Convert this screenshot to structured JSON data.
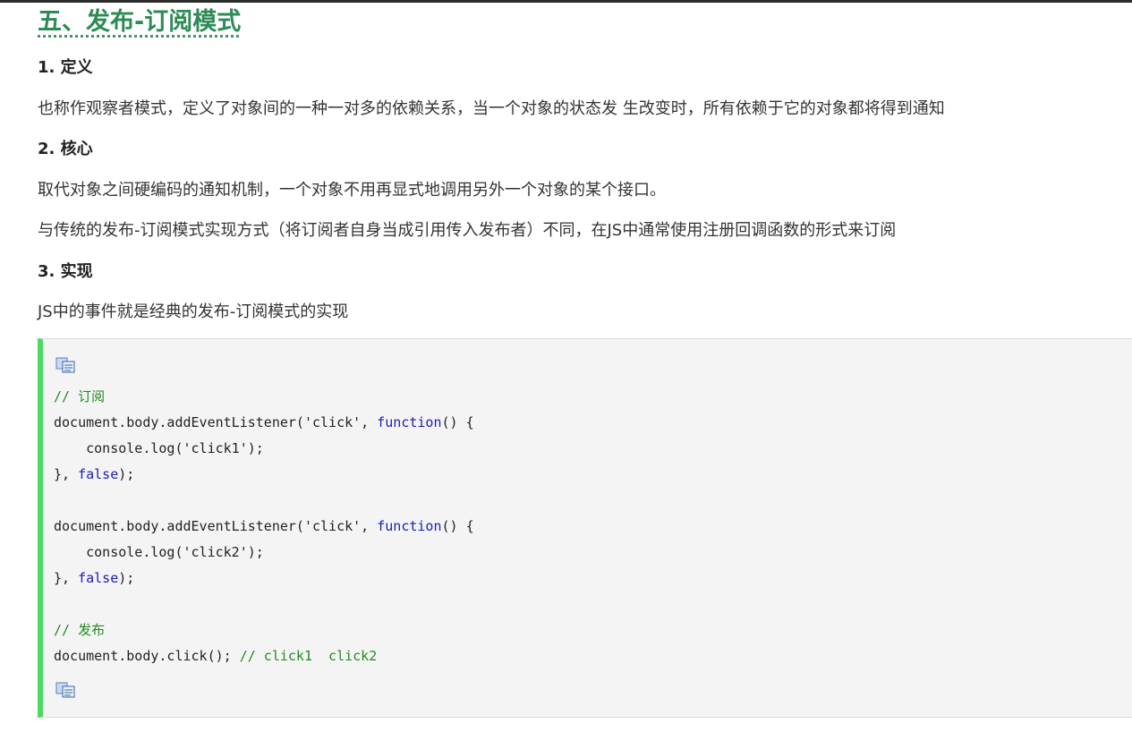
{
  "article": {
    "section_title": "五、发布-订阅模式",
    "heading_1": "1. 定义",
    "para_1": "也称作观察者模式，定义了对象间的一种一对多的依赖关系，当一个对象的状态发 生改变时，所有依赖于它的对象都将得到通知",
    "heading_2": "2. 核心",
    "para_2": "取代对象之间硬编码的通知机制，一个对象不用再显式地调用另外一个对象的某个接口。",
    "para_3": "与传统的发布-订阅模式实现方式（将订阅者自身当成引用传入发布者）不同，在JS中通常使用注册回调函数的形式来订阅",
    "heading_3": "3. 实现",
    "para_4": "JS中的事件就是经典的发布-订阅模式的实现"
  },
  "code": {
    "copy_icon": "copy-icon",
    "lines": [
      [
        {
          "t": "// 订阅",
          "c": "cmt"
        }
      ],
      [
        {
          "t": "document.body.addEventListener('click', ",
          "c": ""
        },
        {
          "t": "function",
          "c": "kw"
        },
        {
          "t": "() {",
          "c": ""
        }
      ],
      [
        {
          "t": "    console.log('click1');",
          "c": ""
        }
      ],
      [
        {
          "t": "}, ",
          "c": ""
        },
        {
          "t": "false",
          "c": "kw"
        },
        {
          "t": ");",
          "c": ""
        }
      ],
      [
        {
          "t": "",
          "c": ""
        }
      ],
      [
        {
          "t": "document.body.addEventListener('click', ",
          "c": ""
        },
        {
          "t": "function",
          "c": "kw"
        },
        {
          "t": "() {",
          "c": ""
        }
      ],
      [
        {
          "t": "    console.log('click2');",
          "c": ""
        }
      ],
      [
        {
          "t": "}, ",
          "c": ""
        },
        {
          "t": "false",
          "c": "kw"
        },
        {
          "t": ");",
          "c": ""
        }
      ],
      [
        {
          "t": "",
          "c": ""
        }
      ],
      [
        {
          "t": "// 发布",
          "c": "cmt"
        }
      ],
      [
        {
          "t": "document.body.click(); ",
          "c": ""
        },
        {
          "t": "// click1  click2",
          "c": "cmt"
        }
      ]
    ]
  }
}
